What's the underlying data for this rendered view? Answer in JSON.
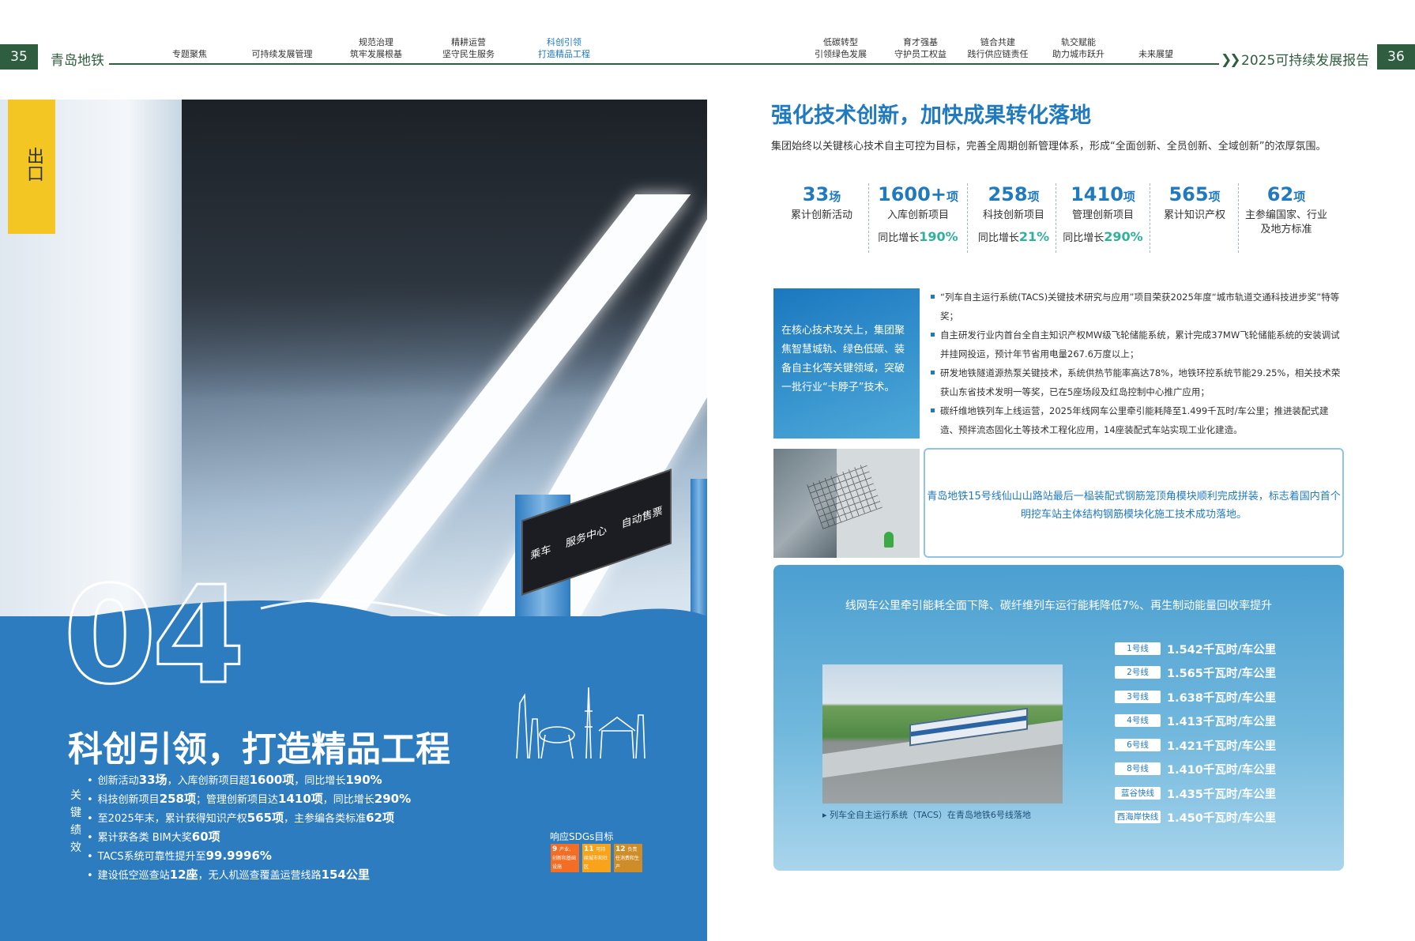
{
  "header": {
    "page_left": "35",
    "page_right": "36",
    "brand": "青岛地铁",
    "report_title": "2025可持续发展报告",
    "nav": [
      {
        "l1": "专题聚焦",
        "l2": ""
      },
      {
        "l1": "可持续发展管理",
        "l2": ""
      },
      {
        "l1": "规范治理",
        "l2": "筑牢发展根基"
      },
      {
        "l1": "精耕运营",
        "l2": "坚守民生服务"
      },
      {
        "l1": "科创引领",
        "l2": "打造精品工程"
      },
      {
        "l1": "低碳转型",
        "l2": "引领绿色发展"
      },
      {
        "l1": "育才强基",
        "l2": "守护员工权益"
      },
      {
        "l1": "链合共建",
        "l2": "践行供应链责任"
      },
      {
        "l1": "轨交赋能",
        "l2": "助力城市跃升"
      },
      {
        "l1": "未来展望",
        "l2": ""
      }
    ]
  },
  "left": {
    "chapter_no": "04",
    "chapter_title": "科创引领，打造精品工程",
    "kpi_vertical": [
      "关",
      "键",
      "绩",
      "效"
    ],
    "kpis": [
      {
        "pre": "创新活动",
        "b1": "33场",
        "mid": "，入库创新项目超",
        "b2": "1600项",
        "post": "，同比增长",
        "b3": "190%"
      },
      {
        "pre": "科技创新项目",
        "b1": "258项",
        "mid": "；管理创新项目达",
        "b2": "1410项",
        "post": "，同比增长",
        "b3": "290%"
      },
      {
        "pre": "至2025年末，累计获得知识产权",
        "b1": "565项",
        "mid": "，主参编各类标准",
        "b2": "62项",
        "post": "",
        "b3": ""
      },
      {
        "pre": "累计获各类 BIM大奖",
        "b1": "60项",
        "mid": "",
        "b2": "",
        "post": "",
        "b3": ""
      },
      {
        "pre": "TACS系统可靠性提升至",
        "b1": "99.9996%",
        "mid": "",
        "b2": "",
        "post": "",
        "b3": ""
      },
      {
        "pre": "建设低空巡查站",
        "b1": "12座",
        "mid": "，无人机巡查覆盖运营线路",
        "b2": "154公里",
        "post": "",
        "b3": ""
      }
    ],
    "sdg_label": "响应SDGs目标",
    "sdgs": [
      {
        "code": "9",
        "text": "产业、创新和基础设施",
        "color": "#f36d25"
      },
      {
        "code": "11",
        "text": "可持续城市和社区",
        "color": "#f9a31b"
      },
      {
        "code": "12",
        "text": "负责任消费和生产",
        "color": "#cf8d2a"
      }
    ],
    "sign_texts": [
      "乘车",
      "服务中心",
      "自动售票"
    ],
    "exit_text": "出口"
  },
  "right": {
    "title": "强化技术创新，加快成果转化落地",
    "intro": "集团始终以关键核心技术自主可控为目标，完善全周期创新管理体系，形成“全面创新、全员创新、全域创新”的浓厚氛围。",
    "stats": [
      {
        "num": "33",
        "unit": "场",
        "label": "累计创新活动",
        "label2": "",
        "grow_pre": "",
        "grow": ""
      },
      {
        "num": "1600+",
        "unit": "项",
        "label": "入库创新项目",
        "label2": "",
        "grow_pre": "同比增长",
        "grow": "190%"
      },
      {
        "num": "258",
        "unit": "项",
        "label": "科技创新项目",
        "label2": "",
        "grow_pre": "同比增长",
        "grow": "21%"
      },
      {
        "num": "1410",
        "unit": "项",
        "label": "管理创新项目",
        "label2": "",
        "grow_pre": "同比增长",
        "grow": "290%"
      },
      {
        "num": "565",
        "unit": "项",
        "label": "累计知识产权",
        "label2": "",
        "grow_pre": "",
        "grow": ""
      },
      {
        "num": "62",
        "unit": "项",
        "label": "主参编国家、行业",
        "label2": "及地方标准",
        "grow_pre": "",
        "grow": ""
      }
    ],
    "bluebox_text": "在核心技术攻关上，集团聚焦智慧城轨、绿色低碳、装备自主化等关键领域，突破一批行业“卡脖子”技术。",
    "bullets": [
      "“列车自主运行系统(TACS)关键技术研究与应用”项目荣获2025年度“城市轨道交通科技进步奖”特等奖；",
      "自主研发行业内首台全自主知识产权MW级飞轮储能系统，累计完成37MW飞轮储能系统的安装调试并挂网投运，预计年节省用电量267.6万度以上；",
      "研发地铁隧道源热泵关键技术，系统供热节能率高达78%，地铁环控系统节能29.25%，相关技术荣获山东省技术发明一等奖，已在5座场段及红岛控制中心推广应用；",
      "碳纤维地铁列车上线运营，2025年线网车公里牵引能耗降至1.499千瓦时/车公里；推进装配式建造、预拌流态固化土等技术工程化应用，14座装配式车站实现工业化建造。"
    ],
    "note": "青岛地铁15号线仙山山路站最后一榀装配式钢筋笼顶角模块顺利完成拼装，标志着国内首个明挖车站主体结构钢筋模块化施工技术成功落地。",
    "energy_title": "线网车公里牵引能耗全面下降、碳纤维列车运行能耗降低7%、再生制动能量回收率提升",
    "train_caption": "列车全自主运行系统（TACS）在青岛地铁6号线落地",
    "lines": [
      {
        "tag": "1号线",
        "value": "1.542千瓦时/车公里"
      },
      {
        "tag": "2号线",
        "value": "1.565千瓦时/车公里"
      },
      {
        "tag": "3号线",
        "value": "1.638千瓦时/车公里"
      },
      {
        "tag": "4号线",
        "value": "1.413千瓦时/车公里"
      },
      {
        "tag": "6号线",
        "value": "1.421千瓦时/车公里"
      },
      {
        "tag": "8号线",
        "value": "1.410千瓦时/车公里"
      },
      {
        "tag": "蓝谷快线",
        "value": "1.435千瓦时/车公里"
      },
      {
        "tag": "西海岸快线",
        "value": "1.450千瓦时/车公里"
      }
    ]
  }
}
